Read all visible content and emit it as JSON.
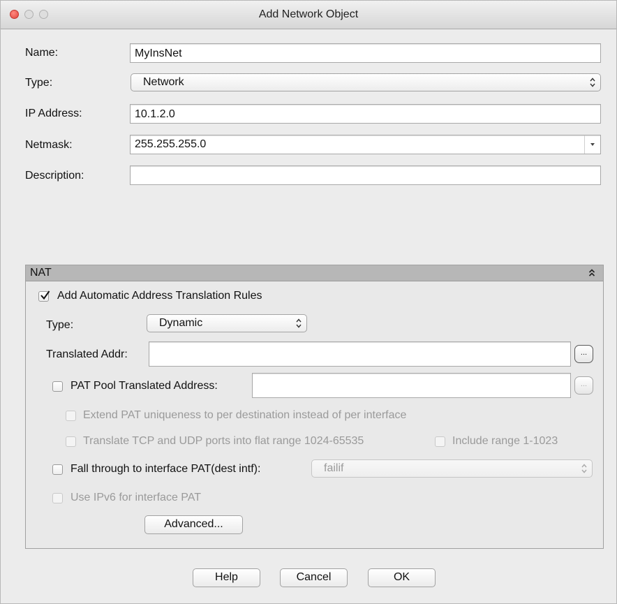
{
  "window": {
    "title": "Add Network Object"
  },
  "form": {
    "name_label": "Name:",
    "name_value": "MyInsNet",
    "type_label": "Type:",
    "type_value": "Network",
    "ip_label": "IP Address:",
    "ip_value": "10.1.2.0",
    "netmask_label": "Netmask:",
    "netmask_value": "255.255.255.0",
    "description_label": "Description:",
    "description_value": ""
  },
  "nat": {
    "header": "NAT",
    "auto_rules_label": "Add Automatic Address Translation Rules",
    "auto_rules_checked": true,
    "type_label": "Type:",
    "type_value": "Dynamic",
    "translated_addr_label": "Translated Addr:",
    "translated_addr_value": "",
    "translated_addr_browse": "...",
    "pat_pool_label": "PAT Pool Translated Address:",
    "pat_pool_checked": false,
    "pat_pool_value": "",
    "pat_pool_browse": "...",
    "extend_pat_label": "Extend PAT uniqueness to per destination instead of per interface",
    "translate_ports_label": "Translate TCP and UDP ports into flat range 1024-65535",
    "include_range_label": "Include range 1-1023",
    "fall_through_label": "Fall through to interface PAT(dest intf):",
    "fall_through_checked": false,
    "fall_through_value": "failif",
    "ipv6_label": "Use IPv6 for interface PAT",
    "advanced_button": "Advanced..."
  },
  "buttons": {
    "help": "Help",
    "cancel": "Cancel",
    "ok": "OK"
  },
  "colors": {
    "close": "#e0443e",
    "panel_header": "#b7b7b7",
    "window_bg": "#ececec"
  }
}
